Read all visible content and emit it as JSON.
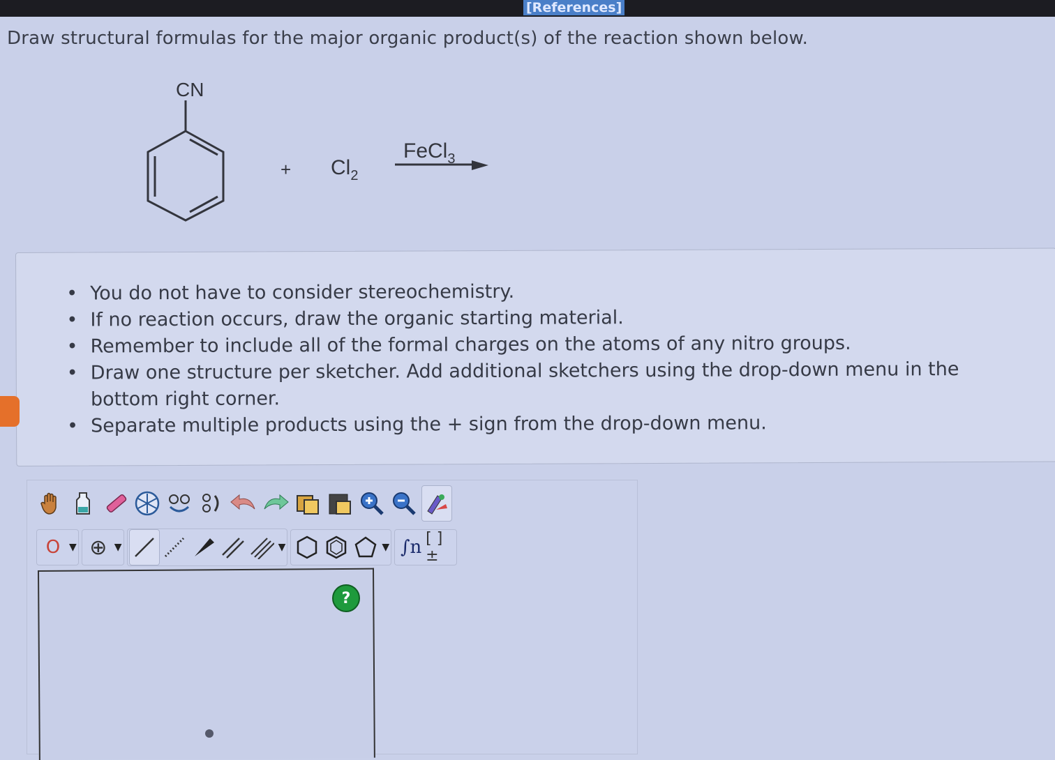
{
  "header": {
    "references_label": "[References]"
  },
  "question": {
    "text": "Draw structural formulas for the major organic product(s) of the reaction shown below."
  },
  "reaction": {
    "substituent_label": "CN",
    "plus_sign": "+",
    "reagent_symbol": "Cl",
    "reagent_subscript": "2",
    "catalyst_symbol": "FeCl",
    "catalyst_subscript": "3"
  },
  "instructions": {
    "items": [
      "You do not have to consider stereochemistry.",
      "If no reaction occurs, draw the organic starting material.",
      "Remember to include all of the formal charges on the atoms of any nitro groups.",
      "Draw one structure per sketcher. Add additional sketchers using the drop-down menu in the bottom right corner.",
      "Separate multiple products using the + sign from the drop-down menu."
    ]
  },
  "toolbar": {
    "row1_icons": [
      "hand-icon",
      "bottle-icon",
      "eraser-icon",
      "template-icon",
      "group-icon",
      "ungroup-icon",
      "undo-icon",
      "redo-icon",
      "copy-icon",
      "paste-icon",
      "zoom-in-icon",
      "zoom-out-icon",
      "clean-icon"
    ],
    "atom_label": "O",
    "charge_label": "⊕",
    "bracket_label": "[ ]±",
    "help_label": "?"
  }
}
